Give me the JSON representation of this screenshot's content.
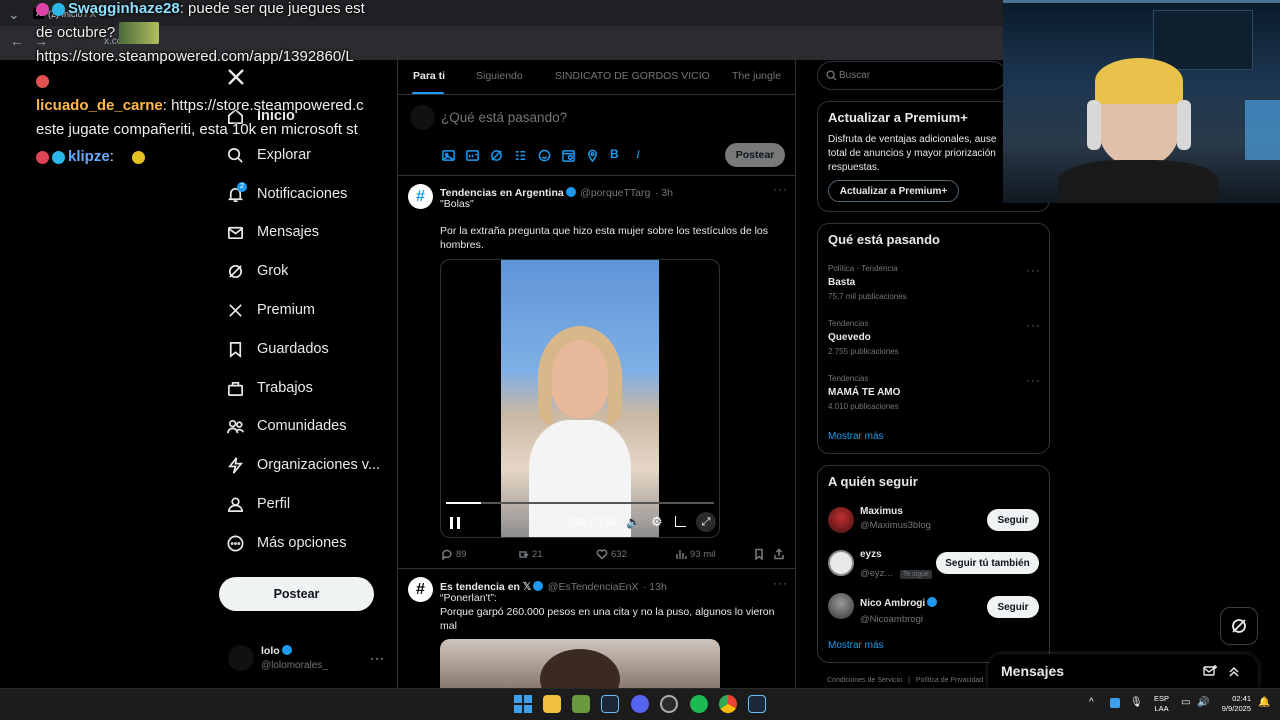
{
  "browser": {
    "tab_title": "(2) Inicio / X",
    "url": "x.com/home"
  },
  "chat": {
    "messages": [
      {
        "user": "Swagginhaze28",
        "text": ": puede ser que juegues est"
      },
      {
        "user": "",
        "text": "de octubre?"
      },
      {
        "user": "",
        "text": "https://store.steampowered.com/app/1392860/L"
      },
      {
        "user": "licuado_de_carne",
        "text": ": https://store.steampowered.c"
      },
      {
        "user": "",
        "text": "este jugate compañeriti, esta 10k en microsoft st"
      },
      {
        "user": "klipze",
        "text": ":"
      }
    ]
  },
  "sidebar": {
    "logo": "X",
    "items": [
      {
        "label": "Inicio",
        "icon": "home-icon"
      },
      {
        "label": "Explorar",
        "icon": "search-icon"
      },
      {
        "label": "Notificaciones",
        "icon": "bell-icon",
        "badge": "2"
      },
      {
        "label": "Mensajes",
        "icon": "mail-icon"
      },
      {
        "label": "Grok",
        "icon": "grok-icon"
      },
      {
        "label": "Premium",
        "icon": "x-icon"
      },
      {
        "label": "Guardados",
        "icon": "bookmark-icon"
      },
      {
        "label": "Trabajos",
        "icon": "briefcase-icon"
      },
      {
        "label": "Comunidades",
        "icon": "people-icon"
      },
      {
        "label": "Organizaciones v...",
        "icon": "lightning-icon"
      },
      {
        "label": "Perfil",
        "icon": "person-icon"
      },
      {
        "label": "Más opciones",
        "icon": "more-circle-icon"
      }
    ],
    "post_button": "Postear",
    "account": {
      "name": "lolo",
      "handle": "@lolomorales_"
    }
  },
  "main": {
    "tabs": [
      "Para ti",
      "Siguiendo",
      "SINDICATO DE GORDOS VICIO",
      "The jungle"
    ],
    "compose_placeholder": "¿Qué está pasando?",
    "post_button": "Postear",
    "tweets": [
      {
        "name": "Tendencias en Argentina",
        "handle": "@porqueTTarg",
        "time": "· 3h",
        "line1": "\"Bolas\"",
        "line2": "Por la extraña pregunta que hizo esta mujer sobre los testículos de los",
        "line3": "hombres.",
        "video_time": "0:02 / 0:18",
        "video_progress": 0.13,
        "replies": "89",
        "retweets": "21",
        "likes": "632",
        "views": "93 mil"
      },
      {
        "name": "Es tendencia en 𝕏",
        "handle": "@EsTendenciaEnX",
        "time": "· 13h",
        "line1": "“Ponerlan't”:",
        "line2": "Porque garpó 260.000 pesos en una cita y no la puso, algunos lo vieron",
        "line3": "mal"
      }
    ]
  },
  "right": {
    "search_placeholder": "Buscar",
    "premium": {
      "title": "Actualizar a Premium+",
      "line1": "Disfruta de ventajas adicionales, ause",
      "line2": "total de anuncios y mayor priorización",
      "line3": "respuestas.",
      "button": "Actualizar a Premium+"
    },
    "trends": {
      "title": "Qué está pasando",
      "items": [
        {
          "category": "Política · Tendencia",
          "name": "Basta",
          "count": "75,7 mil publicaciones"
        },
        {
          "category": "Tendencias",
          "name": "Quevedo",
          "count": "2.755 publicaciones"
        },
        {
          "category": "Tendencias",
          "name": "MAMÁ TE AMO",
          "count": "4.010 publicaciones"
        }
      ],
      "more": "Mostrar más"
    },
    "follow": {
      "title": "A quién seguir",
      "people": [
        {
          "name": "Maximus",
          "handle": "@Maximus3blog",
          "button": "Seguir",
          "tag": ""
        },
        {
          "name": "eyzs",
          "handle": "@eyz...",
          "button": "Seguir tú también",
          "tag": "Te sigue"
        },
        {
          "name": "Nico Ambrogi",
          "handle": "@Nicoambrogi",
          "button": "Seguir",
          "tag": ""
        }
      ],
      "more": "Mostrar más"
    },
    "footer": [
      "Condiciones de Servicio",
      "|",
      "Política de Privacidad"
    ],
    "messages_drawer": "Mensajes"
  },
  "taskbar": {
    "lang1": "ESP",
    "lang2": "LAA",
    "time": "02:41",
    "date": "9/9/2025"
  },
  "colors": {
    "accent": "#1d9bf0",
    "background": "#000000",
    "border": "#2f3336"
  }
}
